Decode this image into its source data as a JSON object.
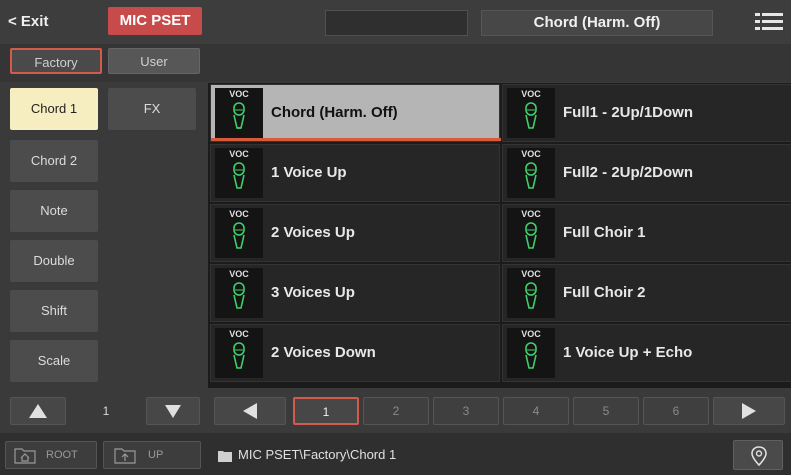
{
  "topbar": {
    "exit_label": "< Exit",
    "mode_label": "MIC PSET",
    "selected_preset": "Chord (Harm. Off)",
    "menu_icon": "hamburger-menu-icon"
  },
  "tabs": {
    "factory": "Factory",
    "user": "User"
  },
  "categories": {
    "left": [
      "Chord 1",
      "Chord 2",
      "Note",
      "Double",
      "Shift",
      "Scale"
    ],
    "right": [
      "FX"
    ],
    "active": "Chord 1"
  },
  "presets": {
    "tag": "VOC",
    "left": [
      "Chord (Harm. Off)",
      "1 Voice Up",
      "2 Voices Up",
      "3 Voices Up",
      "2 Voices Down"
    ],
    "right": [
      "Full1 - 2Up/1Down",
      "Full2 - 2Up/2Down",
      "Full Choir 1",
      "Full Choir 2",
      "1 Voice Up + Echo"
    ],
    "selected": "Chord (Harm. Off)"
  },
  "category_pager": {
    "value": "1"
  },
  "pager": {
    "pages": [
      "1",
      "2",
      "3",
      "4",
      "5",
      "6"
    ],
    "current": "1"
  },
  "status": {
    "root_label": "ROOT",
    "up_label": "UP",
    "path": "MIC PSET\\Factory\\Chord 1"
  },
  "colors": {
    "accent": "#d25b4e",
    "mode_badge": "#c84b4b",
    "active_category": "#f6edc0",
    "mic_icon": "#3fd06a"
  }
}
